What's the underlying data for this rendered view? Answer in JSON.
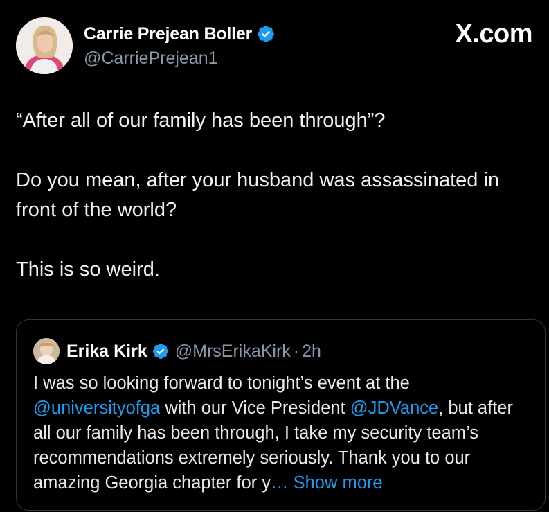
{
  "author": {
    "display_name": "Carrie Prejean Boller",
    "handle": "@CarriePrejean1",
    "verified_icon": "verified-badge-icon"
  },
  "brand": {
    "logo_text": "X.com"
  },
  "tweet": {
    "paragraphs": [
      "“After all of our family has been through”?",
      "Do you mean, after your husband was assassinated in front of the world?",
      "This is so weird."
    ]
  },
  "quoted": {
    "display_name": "Erika Kirk",
    "handle": "@MrsErikaKirk",
    "separator": "·",
    "time": "2h",
    "text_1": "I was so looking forward to tonight’s event at the ",
    "mention_1": "@universityofga",
    "text_2": " with our Vice President ",
    "mention_2": "@JDVance",
    "text_3": ", but after all our family has been through, I take my security team’s recommendations extremely seriously. Thank you to our amazing Georgia chapter for y",
    "show_more": "… Show more"
  },
  "colors": {
    "background": "#000000",
    "text": "#e7e9ea",
    "secondary": "#8b98a5",
    "link": "#1d9bf0",
    "verified": "#1d9bf0",
    "border": "#333639"
  }
}
